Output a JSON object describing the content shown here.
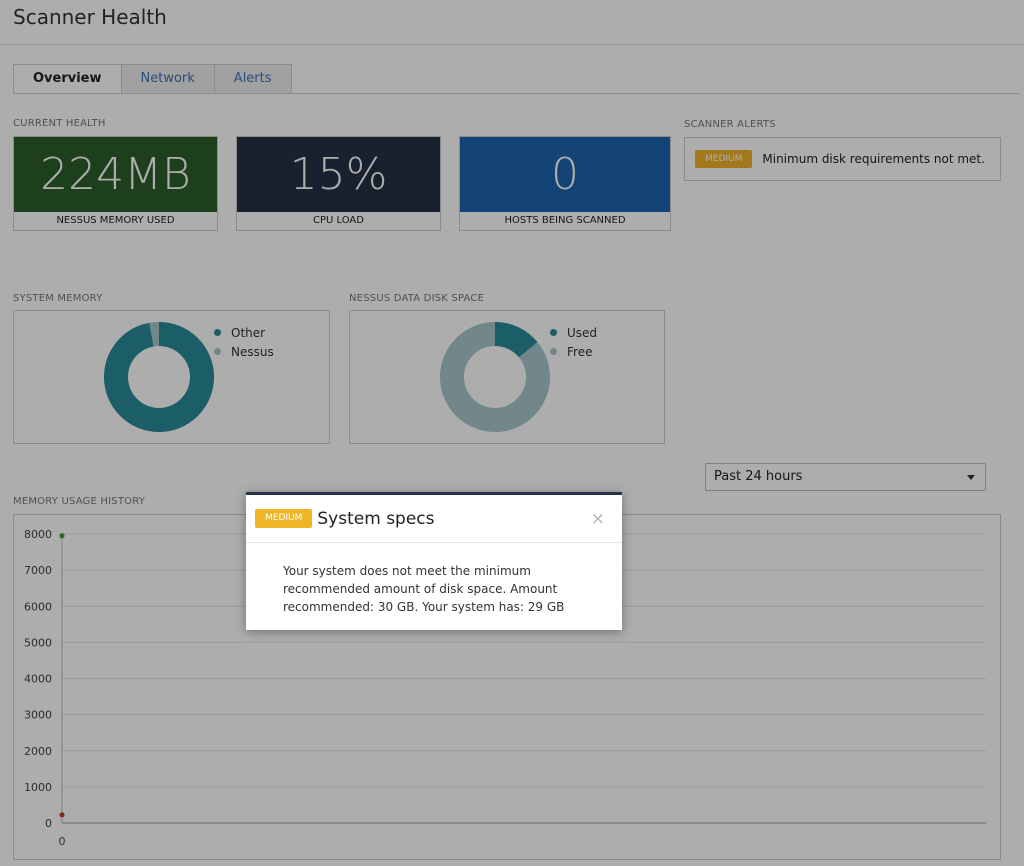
{
  "page": {
    "title": "Scanner Health"
  },
  "tabs": [
    {
      "label": "Overview",
      "active": true
    },
    {
      "label": "Network",
      "active": false
    },
    {
      "label": "Alerts",
      "active": false
    }
  ],
  "current_health": {
    "label": "CURRENT HEALTH",
    "cards": [
      {
        "value": "224MB",
        "label": "NESSUS MEMORY USED",
        "color": "#2c5e2a"
      },
      {
        "value": "15%",
        "label": "CPU LOAD",
        "color": "#263245"
      },
      {
        "value": "0",
        "label": "HOSTS BEING SCANNED",
        "color": "#1e63ad"
      }
    ]
  },
  "scanner_alerts": {
    "label": "SCANNER ALERTS",
    "items": [
      {
        "severity": "MEDIUM",
        "text": "Minimum disk requirements not met."
      }
    ]
  },
  "system_memory": {
    "label": "SYSTEM MEMORY",
    "legend": [
      {
        "label": "Other",
        "color": "#2a8b98"
      },
      {
        "label": "Nessus",
        "color": "#a7c8cc"
      }
    ],
    "other_fraction": 0.97,
    "nessus_fraction": 0.03
  },
  "disk_space": {
    "label": "NESSUS DATA DISK SPACE",
    "legend": [
      {
        "label": "Used",
        "color": "#2a8b98"
      },
      {
        "label": "Free",
        "color": "#a7c8cc"
      }
    ],
    "used_fraction": 0.14,
    "free_fraction": 0.86
  },
  "time_range": {
    "selected": "Past 24 hours"
  },
  "memory_history": {
    "label": "MEMORY USAGE HISTORY",
    "chart_data": {
      "type": "line",
      "title": "",
      "xlabel": "",
      "ylabel": "",
      "ylim": [
        0,
        8000
      ],
      "yticks": [
        "8000",
        "7000",
        "6000",
        "5000",
        "4000",
        "3000",
        "2000",
        "1000",
        "0"
      ],
      "xticks": [
        "0"
      ],
      "series": [
        {
          "values": [
            7950
          ],
          "x": [
            0
          ],
          "color": "#3a9a2a"
        },
        {
          "values": [
            224
          ],
          "x": [
            0
          ],
          "color": "#c0392b"
        }
      ]
    }
  },
  "modal": {
    "severity": "MEDIUM",
    "title": "System specs",
    "close_glyph": "×",
    "body": "Your system does not meet the minimum recommended amount of disk space. Amount recommended: 30 GB. Your system has: 29 GB"
  }
}
